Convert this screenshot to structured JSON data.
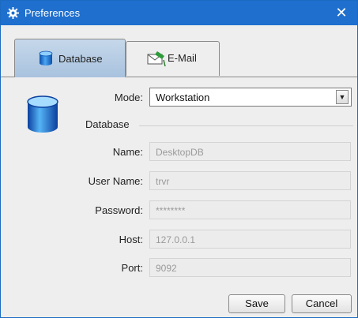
{
  "window": {
    "title": "Preferences",
    "close_glyph": "✕"
  },
  "tabs": [
    {
      "label": "Database",
      "icon": "database-icon",
      "active": true
    },
    {
      "label": "E-Mail",
      "icon": "email-icon",
      "active": false
    }
  ],
  "form": {
    "mode": {
      "label": "Mode:",
      "value": "Workstation",
      "arrow": "▼"
    },
    "section_title": "Database",
    "name": {
      "label": "Name:",
      "value": "DesktopDB"
    },
    "user_name": {
      "label": "User Name:",
      "value": "trvr"
    },
    "password": {
      "label": "Password:",
      "value": "********"
    },
    "host": {
      "label": "Host:",
      "value": "127.0.0.1"
    },
    "port": {
      "label": "Port:",
      "value": "9092"
    }
  },
  "buttons": {
    "save": "Save",
    "cancel": "Cancel"
  },
  "colors": {
    "titlebar": "#1e6fce",
    "tab_active": "#b4cbe4",
    "background": "#eeeeee"
  }
}
